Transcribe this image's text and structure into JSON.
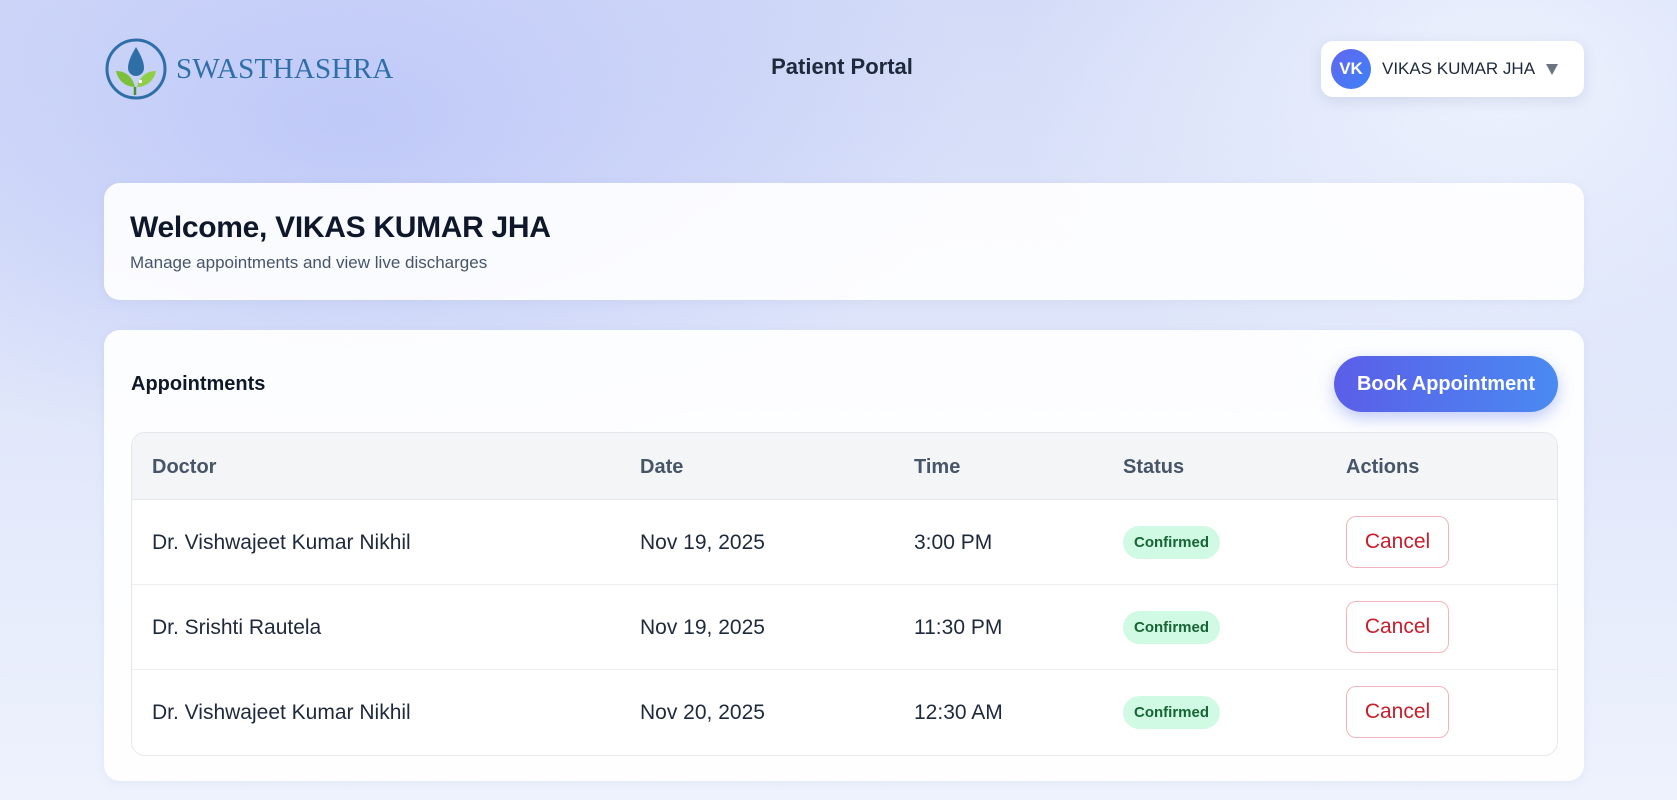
{
  "header": {
    "logo_text": "SWASTHASHRA",
    "portal_title": "Patient Portal",
    "user": {
      "initials": "VK",
      "name": "VIKAS KUMAR JHA"
    }
  },
  "welcome": {
    "title": "Welcome, VIKAS KUMAR JHA",
    "subtitle": "Manage appointments and view live discharges"
  },
  "appointments": {
    "title": "Appointments",
    "book_label": "Book Appointment",
    "columns": [
      "Doctor",
      "Date",
      "Time",
      "Status",
      "Actions"
    ],
    "rows": [
      {
        "doctor": "Dr. Vishwajeet Kumar Nikhil",
        "date": "Nov 19, 2025",
        "time": "3:00 PM",
        "status": "Confirmed",
        "action": "Cancel"
      },
      {
        "doctor": "Dr. Srishti Rautela",
        "date": "Nov 19, 2025",
        "time": "11:30 PM",
        "status": "Confirmed",
        "action": "Cancel"
      },
      {
        "doctor": "Dr. Vishwajeet Kumar Nikhil",
        "date": "Nov 20, 2025",
        "time": "12:30 AM",
        "status": "Confirmed",
        "action": "Cancel"
      }
    ]
  },
  "colors": {
    "accent_start": "#5b5ee8",
    "accent_end": "#4a8af2",
    "status_confirmed_bg": "#d1fae5",
    "status_confirmed_text": "#166534",
    "cancel_text": "#c81e2c"
  },
  "icons": [
    "leaf-drop-logo-icon",
    "chevron-down-icon"
  ]
}
